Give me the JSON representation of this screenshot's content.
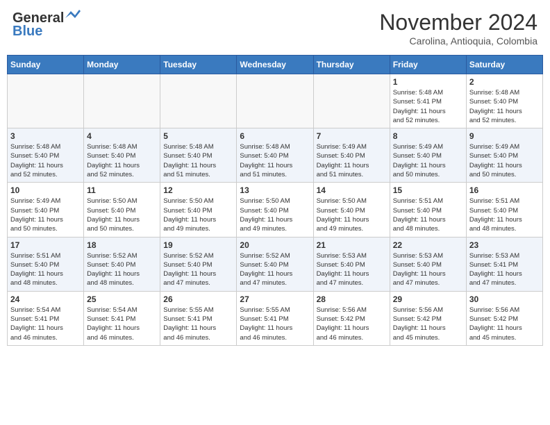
{
  "header": {
    "logo_general": "General",
    "logo_blue": "Blue",
    "month": "November 2024",
    "location": "Carolina, Antioquia, Colombia"
  },
  "days_of_week": [
    "Sunday",
    "Monday",
    "Tuesday",
    "Wednesday",
    "Thursday",
    "Friday",
    "Saturday"
  ],
  "weeks": [
    [
      {
        "day": "",
        "info": ""
      },
      {
        "day": "",
        "info": ""
      },
      {
        "day": "",
        "info": ""
      },
      {
        "day": "",
        "info": ""
      },
      {
        "day": "",
        "info": ""
      },
      {
        "day": "1",
        "info": "Sunrise: 5:48 AM\nSunset: 5:41 PM\nDaylight: 11 hours\nand 52 minutes."
      },
      {
        "day": "2",
        "info": "Sunrise: 5:48 AM\nSunset: 5:40 PM\nDaylight: 11 hours\nand 52 minutes."
      }
    ],
    [
      {
        "day": "3",
        "info": "Sunrise: 5:48 AM\nSunset: 5:40 PM\nDaylight: 11 hours\nand 52 minutes."
      },
      {
        "day": "4",
        "info": "Sunrise: 5:48 AM\nSunset: 5:40 PM\nDaylight: 11 hours\nand 52 minutes."
      },
      {
        "day": "5",
        "info": "Sunrise: 5:48 AM\nSunset: 5:40 PM\nDaylight: 11 hours\nand 51 minutes."
      },
      {
        "day": "6",
        "info": "Sunrise: 5:48 AM\nSunset: 5:40 PM\nDaylight: 11 hours\nand 51 minutes."
      },
      {
        "day": "7",
        "info": "Sunrise: 5:49 AM\nSunset: 5:40 PM\nDaylight: 11 hours\nand 51 minutes."
      },
      {
        "day": "8",
        "info": "Sunrise: 5:49 AM\nSunset: 5:40 PM\nDaylight: 11 hours\nand 50 minutes."
      },
      {
        "day": "9",
        "info": "Sunrise: 5:49 AM\nSunset: 5:40 PM\nDaylight: 11 hours\nand 50 minutes."
      }
    ],
    [
      {
        "day": "10",
        "info": "Sunrise: 5:49 AM\nSunset: 5:40 PM\nDaylight: 11 hours\nand 50 minutes."
      },
      {
        "day": "11",
        "info": "Sunrise: 5:50 AM\nSunset: 5:40 PM\nDaylight: 11 hours\nand 50 minutes."
      },
      {
        "day": "12",
        "info": "Sunrise: 5:50 AM\nSunset: 5:40 PM\nDaylight: 11 hours\nand 49 minutes."
      },
      {
        "day": "13",
        "info": "Sunrise: 5:50 AM\nSunset: 5:40 PM\nDaylight: 11 hours\nand 49 minutes."
      },
      {
        "day": "14",
        "info": "Sunrise: 5:50 AM\nSunset: 5:40 PM\nDaylight: 11 hours\nand 49 minutes."
      },
      {
        "day": "15",
        "info": "Sunrise: 5:51 AM\nSunset: 5:40 PM\nDaylight: 11 hours\nand 48 minutes."
      },
      {
        "day": "16",
        "info": "Sunrise: 5:51 AM\nSunset: 5:40 PM\nDaylight: 11 hours\nand 48 minutes."
      }
    ],
    [
      {
        "day": "17",
        "info": "Sunrise: 5:51 AM\nSunset: 5:40 PM\nDaylight: 11 hours\nand 48 minutes."
      },
      {
        "day": "18",
        "info": "Sunrise: 5:52 AM\nSunset: 5:40 PM\nDaylight: 11 hours\nand 48 minutes."
      },
      {
        "day": "19",
        "info": "Sunrise: 5:52 AM\nSunset: 5:40 PM\nDaylight: 11 hours\nand 47 minutes."
      },
      {
        "day": "20",
        "info": "Sunrise: 5:52 AM\nSunset: 5:40 PM\nDaylight: 11 hours\nand 47 minutes."
      },
      {
        "day": "21",
        "info": "Sunrise: 5:53 AM\nSunset: 5:40 PM\nDaylight: 11 hours\nand 47 minutes."
      },
      {
        "day": "22",
        "info": "Sunrise: 5:53 AM\nSunset: 5:40 PM\nDaylight: 11 hours\nand 47 minutes."
      },
      {
        "day": "23",
        "info": "Sunrise: 5:53 AM\nSunset: 5:41 PM\nDaylight: 11 hours\nand 47 minutes."
      }
    ],
    [
      {
        "day": "24",
        "info": "Sunrise: 5:54 AM\nSunset: 5:41 PM\nDaylight: 11 hours\nand 46 minutes."
      },
      {
        "day": "25",
        "info": "Sunrise: 5:54 AM\nSunset: 5:41 PM\nDaylight: 11 hours\nand 46 minutes."
      },
      {
        "day": "26",
        "info": "Sunrise: 5:55 AM\nSunset: 5:41 PM\nDaylight: 11 hours\nand 46 minutes."
      },
      {
        "day": "27",
        "info": "Sunrise: 5:55 AM\nSunset: 5:41 PM\nDaylight: 11 hours\nand 46 minutes."
      },
      {
        "day": "28",
        "info": "Sunrise: 5:56 AM\nSunset: 5:42 PM\nDaylight: 11 hours\nand 46 minutes."
      },
      {
        "day": "29",
        "info": "Sunrise: 5:56 AM\nSunset: 5:42 PM\nDaylight: 11 hours\nand 45 minutes."
      },
      {
        "day": "30",
        "info": "Sunrise: 5:56 AM\nSunset: 5:42 PM\nDaylight: 11 hours\nand 45 minutes."
      }
    ]
  ]
}
